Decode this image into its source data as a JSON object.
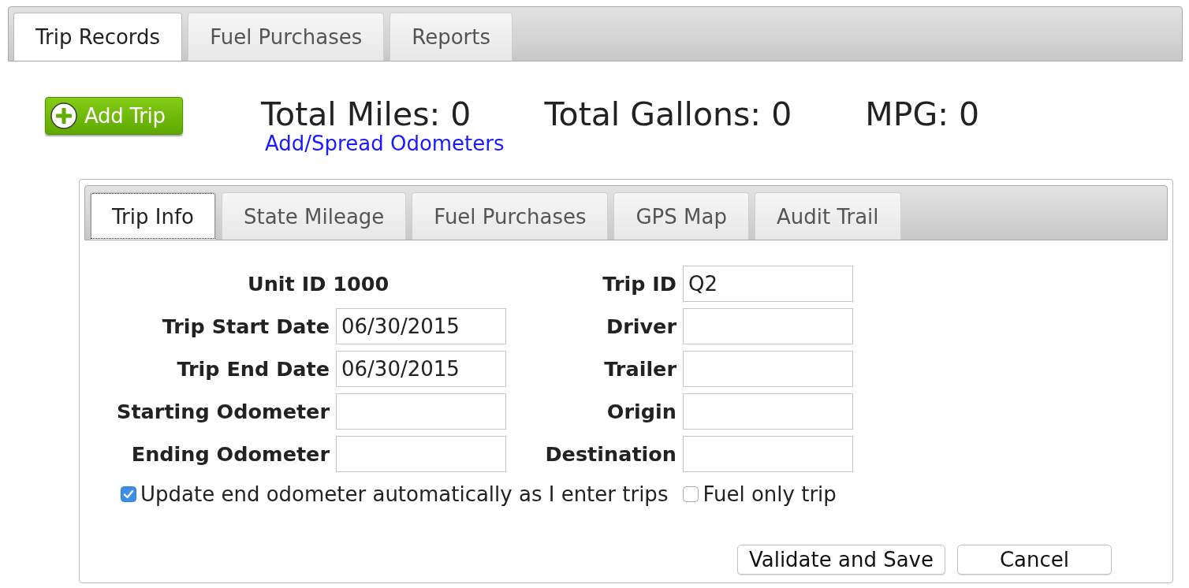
{
  "tabs": [
    {
      "label": "Trip Records",
      "selected": true
    },
    {
      "label": "Fuel Purchases",
      "selected": false
    },
    {
      "label": "Reports",
      "selected": false
    }
  ],
  "summary": {
    "add_button": "Add Trip",
    "totals": [
      "Total Miles: 0",
      "Total Gallons: 0",
      "MPG: 0"
    ],
    "link": "Add/Spread Odometers"
  },
  "trip_panel": {
    "tabs": [
      {
        "label": "Trip Info",
        "selected": true
      },
      {
        "label": "State Mileage",
        "selected": false
      },
      {
        "label": "Fuel Purchases",
        "selected": false
      },
      {
        "label": "GPS Map",
        "selected": false
      },
      {
        "label": "Audit Trail",
        "selected": false
      }
    ],
    "fields_left": [
      {
        "kind": "text",
        "label": "Unit ID 1000"
      },
      {
        "kind": "input",
        "label": "Trip Start Date",
        "value": "06/30/2015"
      },
      {
        "kind": "input",
        "label": "Trip End Date",
        "value": "06/30/2015"
      },
      {
        "kind": "input",
        "label": "Starting Odometer"
      },
      {
        "kind": "input",
        "label": "Ending Odometer"
      }
    ],
    "fields_right": [
      {
        "kind": "input",
        "label": "Trip ID",
        "value": "Q2"
      },
      {
        "kind": "input",
        "label": "Driver"
      },
      {
        "kind": "input",
        "label": "Trailer"
      },
      {
        "kind": "input",
        "label": "Origin"
      },
      {
        "kind": "input",
        "label": "Destination"
      }
    ],
    "checkboxes": [
      {
        "label": "Update end odometer automatically as I enter trips",
        "checked": true
      },
      {
        "label": "Fuel only trip",
        "checked": false
      }
    ],
    "buttons": [
      "Validate and Save",
      "Cancel"
    ]
  }
}
